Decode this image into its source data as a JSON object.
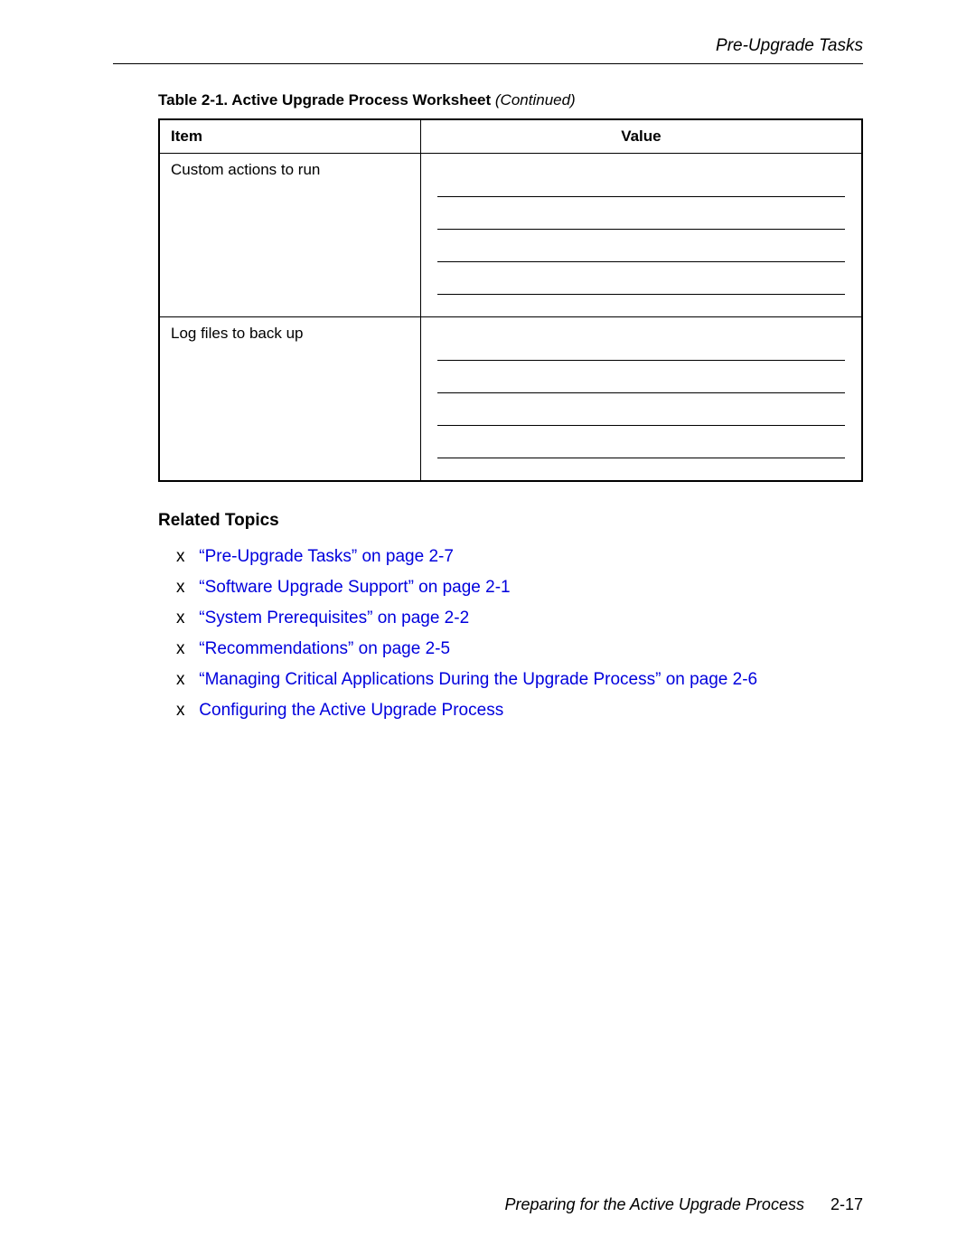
{
  "header": {
    "section_title": "Pre-Upgrade Tasks"
  },
  "table": {
    "caption_prefix": "Table 2-1. Active Upgrade Process Worksheet ",
    "caption_suffix": "(Continued)",
    "headers": {
      "item": "Item",
      "value": "Value"
    },
    "rows": [
      {
        "item": "Custom actions to run"
      },
      {
        "item": "Log files to back up"
      }
    ]
  },
  "related_topics": {
    "heading": "Related Topics",
    "bullet": "x",
    "items": [
      "“Pre-Upgrade Tasks” on page 2-7",
      "“Software Upgrade Support” on page 2-1",
      "“System Prerequisites” on page 2-2",
      "“Recommendations” on page 2-5",
      "“Managing Critical Applications During the Upgrade Process” on page 2-6",
      "Configuring the Active Upgrade Process"
    ]
  },
  "footer": {
    "chapter": "Preparing for the Active Upgrade Process",
    "page": "2-17"
  }
}
